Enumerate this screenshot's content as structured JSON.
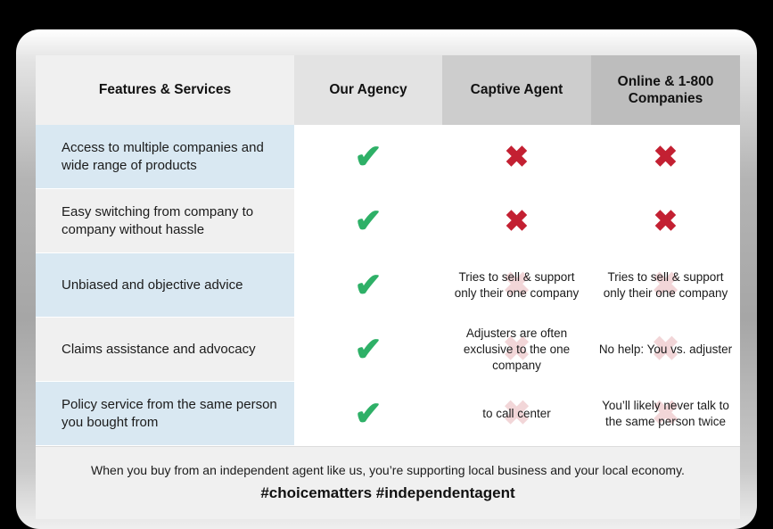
{
  "colors": {
    "check_green": "#2eb067",
    "cross_red": "#c32032",
    "ghost_pink": "#f2d6d8",
    "row_blue": "#d9e8f2",
    "row_gray": "#f0f0f0"
  },
  "table": {
    "headers": [
      "Features & Services",
      "Our Agency",
      "Captive Agent",
      "Online & 1-800 Companies"
    ],
    "rows": [
      {
        "feature": "Access to multiple companies and wide range of products",
        "our_agency": {
          "type": "check",
          "glyph": "✔"
        },
        "captive_agent": {
          "type": "cross",
          "glyph": "✖"
        },
        "online": {
          "type": "cross",
          "glyph": "✖"
        }
      },
      {
        "feature": "Easy switching from company to company without hassle",
        "our_agency": {
          "type": "check",
          "glyph": "✔"
        },
        "captive_agent": {
          "type": "cross",
          "glyph": "✖"
        },
        "online": {
          "type": "cross",
          "glyph": "✖"
        }
      },
      {
        "feature": "Unbiased and objective advice",
        "our_agency": {
          "type": "check",
          "glyph": "✔"
        },
        "captive_agent": {
          "type": "note",
          "glyph": "✖",
          "text": "Tries to sell & support only their one company"
        },
        "online": {
          "type": "note",
          "glyph": "✖",
          "text": "Tries to sell & support only their one company"
        }
      },
      {
        "feature": "Claims assistance and advocacy",
        "our_agency": {
          "type": "check",
          "glyph": "✔"
        },
        "captive_agent": {
          "type": "note",
          "glyph": "✖",
          "text": "Adjusters are often exclusive to the one company"
        },
        "online": {
          "type": "note",
          "glyph": "✖",
          "text": "No help: You vs. adjuster"
        }
      },
      {
        "feature": "Policy service from the same person you bought from",
        "our_agency": {
          "type": "check",
          "glyph": "✔"
        },
        "captive_agent": {
          "type": "note",
          "glyph": "✖",
          "text": "to call center"
        },
        "online": {
          "type": "note",
          "glyph": "✖",
          "text": "You’ll likely never talk to the same person twice"
        }
      }
    ]
  },
  "footer": {
    "tagline": "When you buy from an independent agent like us, you’re supporting local business and your local economy.",
    "hashtags": "#choicematters #independentagent"
  }
}
